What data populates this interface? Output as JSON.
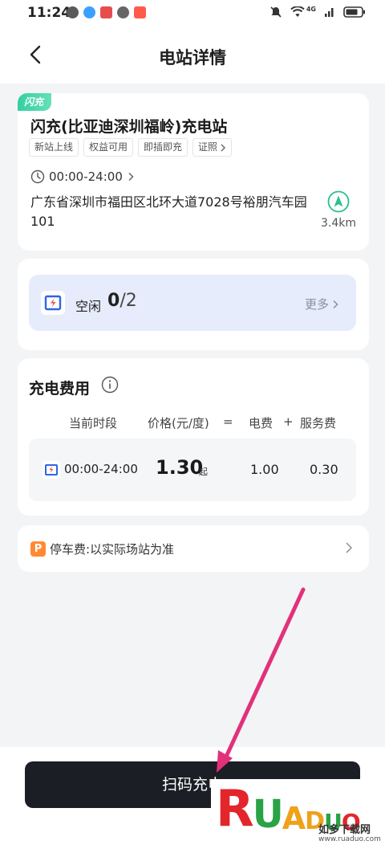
{
  "status_bar": {
    "time": "11:24",
    "network_label": "4G",
    "colors": {
      "chat": "#3aa0ff",
      "app1": "#e84d4d",
      "app2": "#ff5a4a"
    }
  },
  "header": {
    "title": "电站详情",
    "back_icon": "chevron-left-icon"
  },
  "station": {
    "flash_tag": "闪充",
    "name": "闪充(比亚迪深圳福岭)充电站",
    "tags": [
      "新站上线",
      "权益可用",
      "即插即充",
      "证照"
    ],
    "hours": "00:00-24:00",
    "address": "广东省深圳市福田区北环大道7028号裕朋汽车园101",
    "distance": "3.4km"
  },
  "availability": {
    "label": "空闲",
    "idle": "0",
    "total": "/2",
    "more": "更多"
  },
  "fees": {
    "title": "充电费用",
    "headers": {
      "period": "当前时段",
      "price": "价格(元/度)",
      "equals": "=",
      "electricity": "电费",
      "plus": "+",
      "service": "服务费"
    },
    "row": {
      "time": "00:00-24:00",
      "price": "1.30",
      "price_suffix": "起",
      "electricity": "1.00",
      "service": "0.30"
    }
  },
  "parking": {
    "badge": "P",
    "text": "停车费:以实际场站为准"
  },
  "action": {
    "scan_label": "扫码充电"
  },
  "watermark": {
    "letters": [
      "R",
      "U",
      "A",
      "D",
      "U",
      "O"
    ],
    "cn": "如多下载网",
    "url": "www.ruaduo.com"
  },
  "theme": {
    "accent": "#2f64e6",
    "green": "#2bbf8e",
    "annotation": "#e2317a"
  }
}
